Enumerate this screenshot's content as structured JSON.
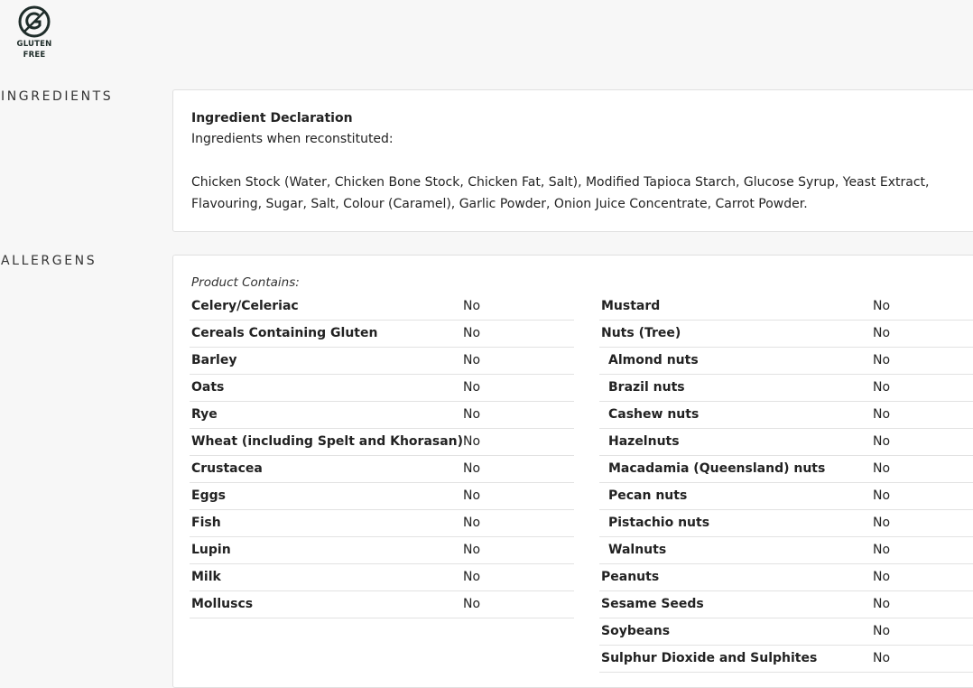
{
  "badge": {
    "label_line1": "GLUTEN",
    "label_line2": "FREE",
    "icon": "gluten-free-icon"
  },
  "ingredients": {
    "section_label": "INGREDIENTS",
    "title": "Ingredient Declaration",
    "subtitle": "Ingredients when reconstituted:",
    "text": "Chicken Stock (Water, Chicken Bone Stock, Chicken Fat, Salt), Modified Tapioca Starch, Glucose Syrup, Yeast Extract, Flavouring, Sugar, Salt, Colour (Caramel), Garlic Powder, Onion Juice Concentrate, Carrot Powder."
  },
  "allergens": {
    "section_label": "ALLERGENS",
    "contains_label": "Product Contains:",
    "left": [
      {
        "name": "Celery/Celeriac",
        "value": "No"
      },
      {
        "name": "Cereals Containing Gluten",
        "value": "No"
      },
      {
        "name": "Barley",
        "value": "No"
      },
      {
        "name": "Oats",
        "value": "No"
      },
      {
        "name": "Rye",
        "value": "No"
      },
      {
        "name": "Wheat (including Spelt and Khorasan)",
        "value": "No"
      },
      {
        "name": "Crustacea",
        "value": "No"
      },
      {
        "name": "Eggs",
        "value": "No"
      },
      {
        "name": "Fish",
        "value": "No"
      },
      {
        "name": "Lupin",
        "value": "No"
      },
      {
        "name": "Milk",
        "value": "No"
      },
      {
        "name": "Molluscs",
        "value": "No"
      }
    ],
    "right": [
      {
        "name": "Mustard",
        "value": "No"
      },
      {
        "name": "Nuts (Tree)",
        "value": "No"
      },
      {
        "name": "Almond nuts",
        "value": "No"
      },
      {
        "name": "Brazil nuts",
        "value": "No"
      },
      {
        "name": "Cashew nuts",
        "value": "No"
      },
      {
        "name": "Hazelnuts",
        "value": "No"
      },
      {
        "name": "Macadamia (Queensland) nuts",
        "value": "No"
      },
      {
        "name": "Pecan nuts",
        "value": "No"
      },
      {
        "name": "Pistachio nuts",
        "value": "No"
      },
      {
        "name": "Walnuts",
        "value": "No"
      },
      {
        "name": "Peanuts",
        "value": "No"
      },
      {
        "name": "Sesame Seeds",
        "value": "No"
      },
      {
        "name": "Soybeans",
        "value": "No"
      },
      {
        "name": "Sulphur Dioxide and Sulphites",
        "value": "No"
      }
    ]
  }
}
